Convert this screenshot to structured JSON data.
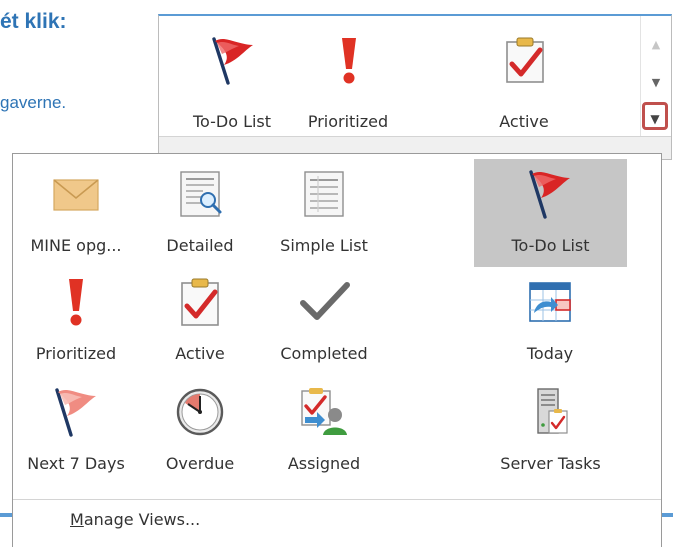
{
  "background": {
    "heading": "ét klik:",
    "text": "gaverne."
  },
  "ribbon": {
    "items": [
      {
        "label": "To-Do List",
        "icon": "red-flag-icon"
      },
      {
        "label": "Prioritized",
        "icon": "exclamation-icon"
      },
      {
        "label": "Active",
        "icon": "clipboard-check-icon"
      }
    ],
    "scroll_up": "▲",
    "scroll_down": "▼",
    "more": "▼"
  },
  "views": [
    {
      "label": "MINE opg...",
      "icon": "envelope-icon",
      "selected": false
    },
    {
      "label": "Detailed",
      "icon": "detailed-list-icon",
      "selected": false
    },
    {
      "label": "Simple List",
      "icon": "simple-list-icon",
      "selected": false
    },
    {
      "label": "To-Do List",
      "icon": "red-flag-icon",
      "selected": true
    },
    {
      "label": "Prioritized",
      "icon": "exclamation-icon",
      "selected": false
    },
    {
      "label": "Active",
      "icon": "clipboard-check-icon",
      "selected": false
    },
    {
      "label": "Completed",
      "icon": "checkmark-icon",
      "selected": false
    },
    {
      "label": "Today",
      "icon": "calendar-arrow-icon",
      "selected": false
    },
    {
      "label": "Next 7 Days",
      "icon": "pink-flag-icon",
      "selected": false
    },
    {
      "label": "Overdue",
      "icon": "clock-icon",
      "selected": false
    },
    {
      "label": "Assigned",
      "icon": "assigned-person-icon",
      "selected": false
    },
    {
      "label": "Server Tasks",
      "icon": "server-tasks-icon",
      "selected": false
    }
  ],
  "manage_views": {
    "mnemonic": "M",
    "rest": "anage Views..."
  },
  "colors": {
    "accent": "#5b9bd5",
    "highlight": "#c0504d",
    "selected_bg": "#c6c6c6",
    "check_red": "#d42a2a"
  }
}
